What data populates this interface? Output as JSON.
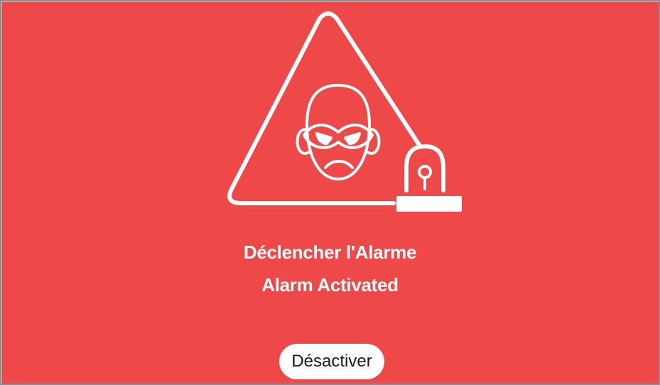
{
  "alarm": {
    "title_fr": "Déclencher l'Alarme",
    "title_en": "Alarm Activated",
    "icon": "intruder-warning-with-siren",
    "background_color": "#ef4848",
    "foreground_color": "#ffffff"
  },
  "actions": {
    "deactivate_label": "Désactiver"
  }
}
